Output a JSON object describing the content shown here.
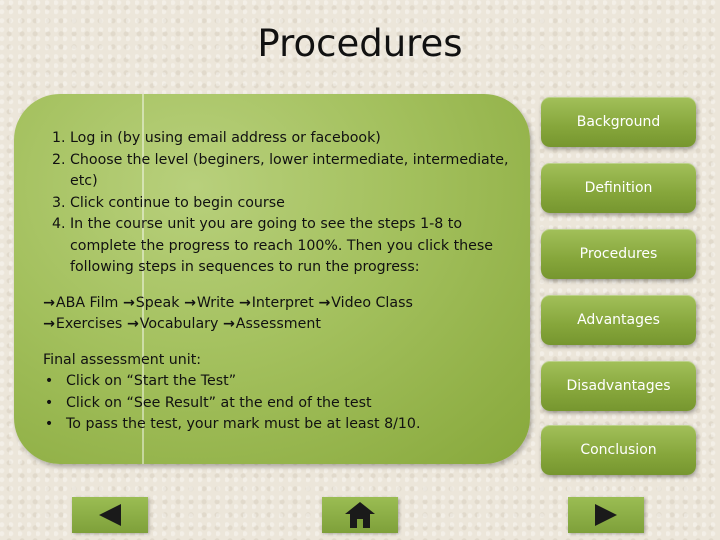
{
  "title": "Procedures",
  "steps": [
    "Log in (by using email address or facebook)",
    "Choose the level (beginers, lower intermediate, intermediate, etc)",
    "Click continue to begin course",
    "In the course unit you are going to see the steps 1-8 to complete the progress to reach 100%. Then you click these following steps in sequences to run the progress:"
  ],
  "flow": [
    "ABA Film",
    "Speak",
    "Write",
    "Interpret",
    "Video Class",
    "Exercises",
    "Vocabulary",
    "Assessment"
  ],
  "final": {
    "heading": "Final assessment unit:",
    "items": [
      "Click on “Start the Test”",
      "Click on “See Result” at the end of the test",
      "To pass the test, your mark must be at least 8/10."
    ]
  },
  "nav": [
    "Background",
    "Definition",
    "Procedures",
    "Advantages",
    "Disadvantages",
    "Conclusion"
  ],
  "controls": {
    "prev_icon": "triangle-left-icon",
    "home_icon": "home-icon",
    "next_icon": "triangle-right-icon"
  }
}
